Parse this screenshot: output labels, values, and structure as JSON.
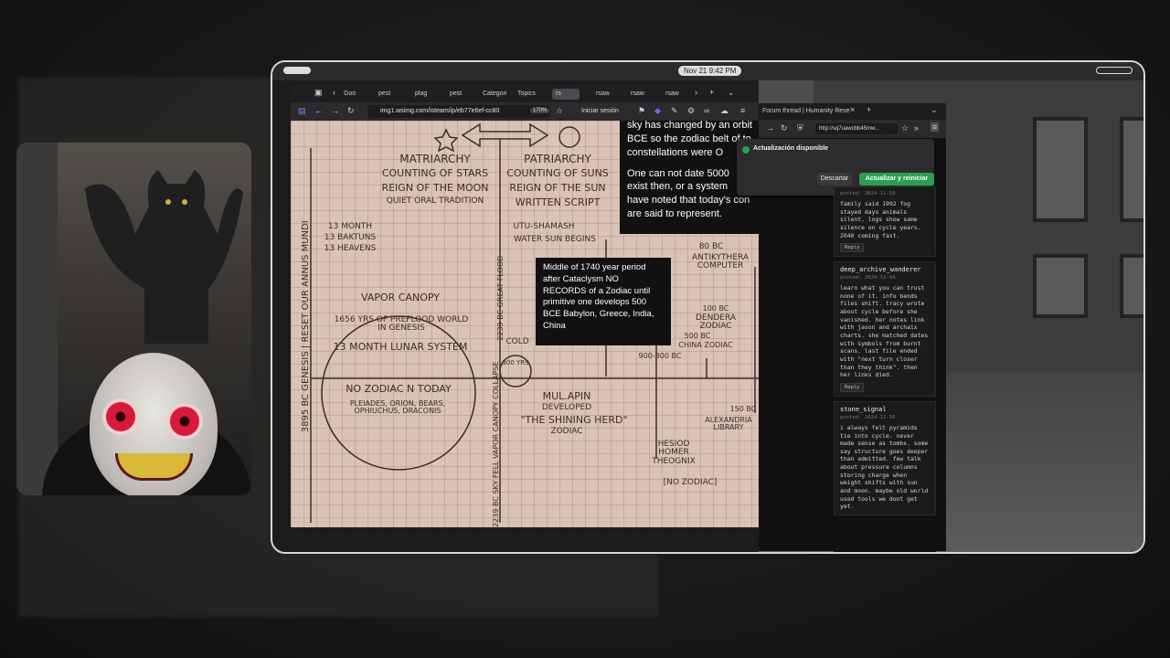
{
  "topbar": {
    "clock": "Nov 21   9:42 PM"
  },
  "left_browser": {
    "tabs": [
      {
        "label": "Goo"
      },
      {
        "label": "pest"
      },
      {
        "label": "plag"
      },
      {
        "label": "pest"
      },
      {
        "label": "Categori"
      },
      {
        "label": "Topics"
      },
      {
        "label": "rs"
      },
      {
        "label": "rsaw"
      },
      {
        "label": "rsaw"
      },
      {
        "label": "rsaw"
      }
    ],
    "url": "img1.wsimg.com/isteam/ip/eb77e6ef-cc80",
    "zoom": "170%",
    "signin": "Iniciar sesión"
  },
  "diagram": {
    "left_axis": "3895 BC  Genesis | Reset  Our Annus Mundi",
    "matriarchy": "Matriarchy",
    "matriarchy_1": "Counting of Stars",
    "matriarchy_2": "Reign of the Moon",
    "matriarchy_3": "Quiet Oral Tradition",
    "patriarchy": "Patriarchy",
    "patriarchy_1": "Counting of Suns",
    "patriarchy_2": "Reign of the Sun",
    "patriarchy_3": "Written Script",
    "months": "13 Month",
    "baktuns": "13 Baktuns",
    "heavens": "13 Heavens",
    "utu": "Utu-Shamash",
    "water_sun": "Water Sun Begins",
    "great_flood": "2239 BC Great Flood",
    "vapor_canopy": "Vapor Canopy",
    "prefood": "1656 yrs of PreFlood World in Genesis",
    "lunar": "13 Month Lunar System",
    "zodiac_today": "No Zodiac N Today",
    "pleiades": "Pleiades, Orion, Bears, Ophiuchus, Draconis",
    "skyfell": "2239 BC Sky Fell  Vapor Canopy Collapse",
    "cold": "Cold",
    "yrs": "300 yrs",
    "mulapin": "Mul.Apin",
    "developed": "Developed",
    "shining_herd": "\"The Shining Herd\"",
    "zodiac": "Zodiac",
    "antikythera_year": "80 BC",
    "antikythera": "Antikythera Computer",
    "dendera_year": "100 BC",
    "dendera": "Dendera Zodiac",
    "china_year": "500 BC",
    "china": "China Zodiac",
    "range": "900-800 BC",
    "library_year": "150 BC",
    "library": "Alexandria Library",
    "hesiod": "Hesiod Homer Theognix",
    "no_zodiac": "[No Zodiac]",
    "callout_top_1": "sky has changed by an orbit",
    "callout_top_2": "BCE so the zodiac belt of to",
    "callout_top_3": "constellations were O",
    "callout_top_4": "One can not date 5000",
    "callout_top_5": "exist then, or a system",
    "callout_top_6": "have noted that today's con",
    "callout_top_7": "are said to represent.",
    "callout_mid": "Middle of 1740 year period after Cataclysm NO RECORDS of a Zodiac until primitive one develops 500 BCE Babylon, Greece, India, China"
  },
  "right_browser": {
    "tab_label": "Forum thread | Humanity Rese",
    "url": "http://sq7uawcbb45mw..."
  },
  "update_popup": {
    "title": "Actualización disponible",
    "dismiss": "Descartar",
    "update": "Actualizar y reiniciar"
  },
  "forum": {
    "posts": [
      {
        "user": "",
        "date": "posted: 2024-11-18",
        "body": "family said 1992 fog stayed days animals silent. logs show same silence on cycle years. 2040 coming fast.",
        "reply": "Reply"
      },
      {
        "user": "deep_archive_wanderer",
        "date": "posted: 2024-12-04",
        "body": "learn what you can trust none of it. info bends files shift. tracy wrote about cycle before she vanished. her notes link with jason and archaix charts. she matched dates with symbols from burnt scans. last file ended with \"next turn closer than they think\". then her links died.",
        "reply": "Reply"
      },
      {
        "user": "stone_signal",
        "date": "posted: 2024-12-16",
        "body": "i always felt pyramids tie into cycle. never made sense as tombs. some say structure goes deeper than admitted. few talk about pressure columns storing charge when weight shifts with sun and moon. maybe old world used tools we dont get yet.",
        "reply": ""
      }
    ]
  }
}
